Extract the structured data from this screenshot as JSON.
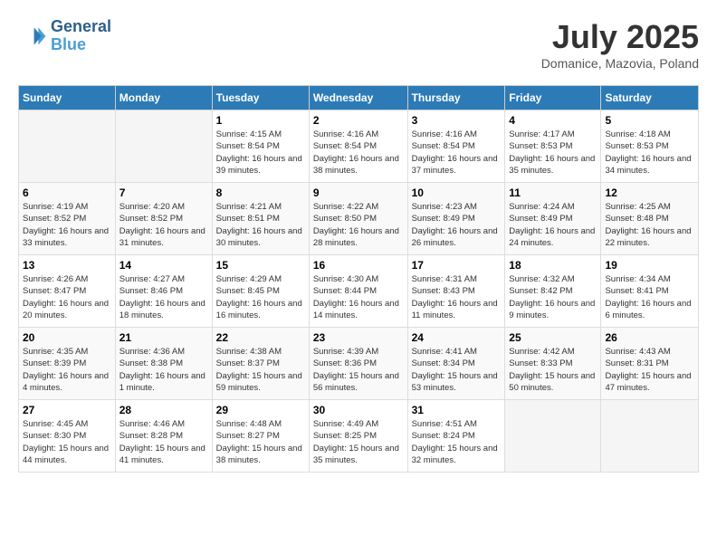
{
  "header": {
    "logo_line1": "General",
    "logo_line2": "Blue",
    "month_title": "July 2025",
    "subtitle": "Domanice, Mazovia, Poland"
  },
  "days_of_week": [
    "Sunday",
    "Monday",
    "Tuesday",
    "Wednesday",
    "Thursday",
    "Friday",
    "Saturday"
  ],
  "weeks": [
    [
      {
        "day": "",
        "info": ""
      },
      {
        "day": "",
        "info": ""
      },
      {
        "day": "1",
        "info": "Sunrise: 4:15 AM\nSunset: 8:54 PM\nDaylight: 16 hours and 39 minutes."
      },
      {
        "day": "2",
        "info": "Sunrise: 4:16 AM\nSunset: 8:54 PM\nDaylight: 16 hours and 38 minutes."
      },
      {
        "day": "3",
        "info": "Sunrise: 4:16 AM\nSunset: 8:54 PM\nDaylight: 16 hours and 37 minutes."
      },
      {
        "day": "4",
        "info": "Sunrise: 4:17 AM\nSunset: 8:53 PM\nDaylight: 16 hours and 35 minutes."
      },
      {
        "day": "5",
        "info": "Sunrise: 4:18 AM\nSunset: 8:53 PM\nDaylight: 16 hours and 34 minutes."
      }
    ],
    [
      {
        "day": "6",
        "info": "Sunrise: 4:19 AM\nSunset: 8:52 PM\nDaylight: 16 hours and 33 minutes."
      },
      {
        "day": "7",
        "info": "Sunrise: 4:20 AM\nSunset: 8:52 PM\nDaylight: 16 hours and 31 minutes."
      },
      {
        "day": "8",
        "info": "Sunrise: 4:21 AM\nSunset: 8:51 PM\nDaylight: 16 hours and 30 minutes."
      },
      {
        "day": "9",
        "info": "Sunrise: 4:22 AM\nSunset: 8:50 PM\nDaylight: 16 hours and 28 minutes."
      },
      {
        "day": "10",
        "info": "Sunrise: 4:23 AM\nSunset: 8:49 PM\nDaylight: 16 hours and 26 minutes."
      },
      {
        "day": "11",
        "info": "Sunrise: 4:24 AM\nSunset: 8:49 PM\nDaylight: 16 hours and 24 minutes."
      },
      {
        "day": "12",
        "info": "Sunrise: 4:25 AM\nSunset: 8:48 PM\nDaylight: 16 hours and 22 minutes."
      }
    ],
    [
      {
        "day": "13",
        "info": "Sunrise: 4:26 AM\nSunset: 8:47 PM\nDaylight: 16 hours and 20 minutes."
      },
      {
        "day": "14",
        "info": "Sunrise: 4:27 AM\nSunset: 8:46 PM\nDaylight: 16 hours and 18 minutes."
      },
      {
        "day": "15",
        "info": "Sunrise: 4:29 AM\nSunset: 8:45 PM\nDaylight: 16 hours and 16 minutes."
      },
      {
        "day": "16",
        "info": "Sunrise: 4:30 AM\nSunset: 8:44 PM\nDaylight: 16 hours and 14 minutes."
      },
      {
        "day": "17",
        "info": "Sunrise: 4:31 AM\nSunset: 8:43 PM\nDaylight: 16 hours and 11 minutes."
      },
      {
        "day": "18",
        "info": "Sunrise: 4:32 AM\nSunset: 8:42 PM\nDaylight: 16 hours and 9 minutes."
      },
      {
        "day": "19",
        "info": "Sunrise: 4:34 AM\nSunset: 8:41 PM\nDaylight: 16 hours and 6 minutes."
      }
    ],
    [
      {
        "day": "20",
        "info": "Sunrise: 4:35 AM\nSunset: 8:39 PM\nDaylight: 16 hours and 4 minutes."
      },
      {
        "day": "21",
        "info": "Sunrise: 4:36 AM\nSunset: 8:38 PM\nDaylight: 16 hours and 1 minute."
      },
      {
        "day": "22",
        "info": "Sunrise: 4:38 AM\nSunset: 8:37 PM\nDaylight: 15 hours and 59 minutes."
      },
      {
        "day": "23",
        "info": "Sunrise: 4:39 AM\nSunset: 8:36 PM\nDaylight: 15 hours and 56 minutes."
      },
      {
        "day": "24",
        "info": "Sunrise: 4:41 AM\nSunset: 8:34 PM\nDaylight: 15 hours and 53 minutes."
      },
      {
        "day": "25",
        "info": "Sunrise: 4:42 AM\nSunset: 8:33 PM\nDaylight: 15 hours and 50 minutes."
      },
      {
        "day": "26",
        "info": "Sunrise: 4:43 AM\nSunset: 8:31 PM\nDaylight: 15 hours and 47 minutes."
      }
    ],
    [
      {
        "day": "27",
        "info": "Sunrise: 4:45 AM\nSunset: 8:30 PM\nDaylight: 15 hours and 44 minutes."
      },
      {
        "day": "28",
        "info": "Sunrise: 4:46 AM\nSunset: 8:28 PM\nDaylight: 15 hours and 41 minutes."
      },
      {
        "day": "29",
        "info": "Sunrise: 4:48 AM\nSunset: 8:27 PM\nDaylight: 15 hours and 38 minutes."
      },
      {
        "day": "30",
        "info": "Sunrise: 4:49 AM\nSunset: 8:25 PM\nDaylight: 15 hours and 35 minutes."
      },
      {
        "day": "31",
        "info": "Sunrise: 4:51 AM\nSunset: 8:24 PM\nDaylight: 15 hours and 32 minutes."
      },
      {
        "day": "",
        "info": ""
      },
      {
        "day": "",
        "info": ""
      }
    ]
  ]
}
